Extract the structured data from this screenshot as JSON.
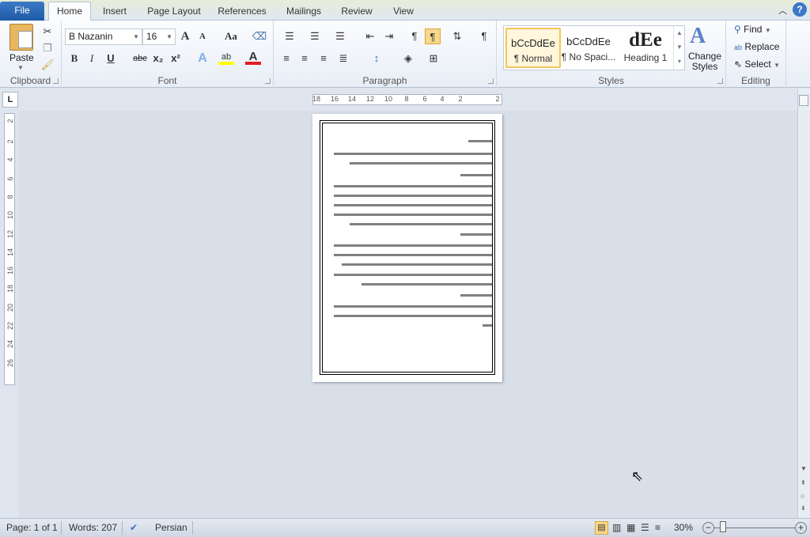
{
  "tabs": {
    "file": "File",
    "home": "Home",
    "insert": "Insert",
    "page_layout": "Page Layout",
    "references": "References",
    "mailings": "Mailings",
    "review": "Review",
    "view": "View"
  },
  "clipboard": {
    "paste": "Paste",
    "label": "Clipboard"
  },
  "font": {
    "name": "B Nazanin",
    "size": "16",
    "label": "Font",
    "bold": "B",
    "italic": "I",
    "underline": "U",
    "strike": "abc",
    "sub": "x₂",
    "sup": "x²",
    "grow": "A",
    "shrink": "A",
    "case": "Aa"
  },
  "paragraph": {
    "label": "Paragraph"
  },
  "styles": {
    "label": "Styles",
    "items": [
      {
        "preview": "bCcDdEe",
        "name": "¶ Normal"
      },
      {
        "preview": "bCcDdEe",
        "name": "¶ No Spaci..."
      },
      {
        "preview": "dEe",
        "name": "Heading 1"
      }
    ],
    "change_styles": "Change Styles",
    "selected": "Normal"
  },
  "editing": {
    "label": "Editing",
    "find": "Find",
    "replace": "Replace",
    "select": "Select"
  },
  "ruler": {
    "h_numbers": [
      "18",
      "16",
      "14",
      "12",
      "10",
      "8",
      "6",
      "4",
      "2",
      "2"
    ],
    "v_numbers": [
      "2",
      "2",
      "4",
      "6",
      "8",
      "10",
      "12",
      "14",
      "16",
      "18",
      "20",
      "22",
      "24",
      "26"
    ]
  },
  "status": {
    "page": "Page: 1 of 1",
    "words": "Words: 207",
    "language": "Persian",
    "zoom": "30%",
    "zoom_percent": 30
  },
  "colors": {
    "file_tab": "#2a66b3",
    "highlight": "#ffff00",
    "font_color": "#e02020",
    "selected_style": "#f2c55c"
  }
}
